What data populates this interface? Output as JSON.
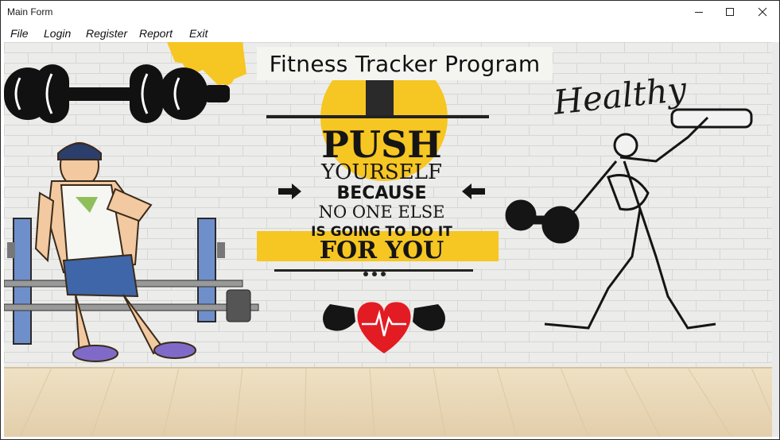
{
  "window": {
    "title": "Main Form"
  },
  "menu": [
    {
      "label": "File"
    },
    {
      "label": "Login"
    },
    {
      "label": "Register"
    },
    {
      "label": "Report"
    },
    {
      "label": "Exit"
    }
  ],
  "banner": {
    "text": "Fitness Tracker Program"
  },
  "poster": {
    "line1": "PUSH",
    "line2": "YOURSELF",
    "line3": "BECAUSE",
    "line4": "NO ONE ELSE",
    "line5": "IS GOING TO DO IT",
    "line6": "FOR YOU"
  },
  "wall_text": "Healthy",
  "colors": {
    "accent_yellow": "#f5c518",
    "heart_red": "#e31b23",
    "wall": "#ececec",
    "floor": "#e6d3b0"
  }
}
